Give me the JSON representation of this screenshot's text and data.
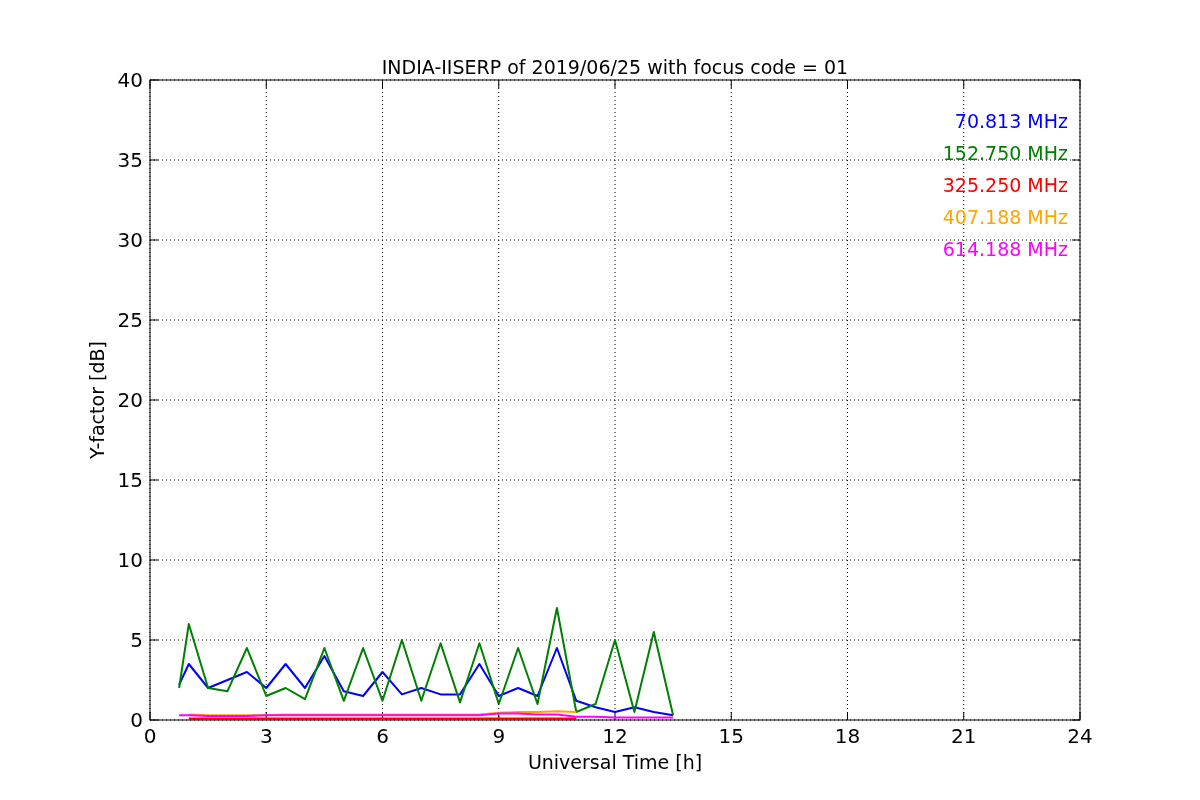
{
  "chart_data": {
    "type": "line",
    "title": "INDIA-IISERP of 2019/06/25 with focus code = 01",
    "xlabel": "Universal Time [h]",
    "ylabel": "Y-factor [dB]",
    "x": [
      0.75,
      1,
      1.5,
      2,
      2.5,
      3,
      3.5,
      4,
      4.5,
      5,
      5.5,
      6,
      6.5,
      7,
      7.5,
      8,
      8.5,
      9,
      9.5,
      10,
      10.5,
      11,
      11.5,
      12,
      12.5,
      13,
      13.5
    ],
    "series": [
      {
        "name": "70.813 MHz",
        "color": "#0000ff",
        "values": [
          2.2,
          3.5,
          2.0,
          2.5,
          3.0,
          2.0,
          3.5,
          2.0,
          4.0,
          1.8,
          1.5,
          3.0,
          1.6,
          2.0,
          1.6,
          1.6,
          3.5,
          1.5,
          2.0,
          1.5,
          4.5,
          1.2,
          0.8,
          0.5,
          0.8,
          0.5,
          0.3
        ]
      },
      {
        "name": "152.750 MHz",
        "color": "#008000",
        "values": [
          2.0,
          6.0,
          2.0,
          1.8,
          4.5,
          1.5,
          2.0,
          1.3,
          4.5,
          1.2,
          4.5,
          1.2,
          5.0,
          1.2,
          4.8,
          1.1,
          4.8,
          1.0,
          4.5,
          1.0,
          7.0,
          0.5,
          1.0,
          5.0,
          0.5,
          5.5,
          0.3
        ]
      },
      {
        "name": "325.250 MHz",
        "color": "#ff0000",
        "values": [
          null,
          0.1,
          0.1,
          0.1,
          0.1,
          0.1,
          0.1,
          0.1,
          0.1,
          0.1,
          0.1,
          0.1,
          0.1,
          0.1,
          0.1,
          0.1,
          0.1,
          0.1,
          0.1,
          0.1,
          0.1,
          0.1,
          null,
          null,
          null,
          null,
          null
        ]
      },
      {
        "name": "407.188 MHz",
        "color": "#ffa500",
        "values": [
          null,
          0.35,
          0.3,
          0.3,
          0.3,
          0.3,
          0.35,
          0.35,
          0.35,
          0.35,
          0.35,
          0.35,
          0.35,
          0.35,
          0.35,
          0.35,
          0.35,
          0.45,
          0.5,
          0.5,
          0.55,
          0.5,
          null,
          null,
          null,
          null,
          null
        ]
      },
      {
        "name": "614.188 MHz",
        "color": "#ff00ff",
        "values": [
          0.3,
          0.3,
          0.25,
          0.25,
          0.25,
          0.3,
          0.3,
          0.3,
          0.3,
          0.3,
          0.3,
          0.3,
          0.3,
          0.3,
          0.3,
          0.3,
          0.3,
          0.4,
          0.4,
          0.35,
          0.35,
          0.2,
          0.2,
          0.15,
          0.15,
          0.15,
          0.15
        ]
      }
    ],
    "grid": true,
    "xlim": [
      0,
      24
    ],
    "ylim": [
      0,
      40
    ],
    "xticks": [
      0,
      3,
      6,
      9,
      12,
      15,
      18,
      21,
      24
    ],
    "yticks": [
      0,
      5,
      10,
      15,
      20,
      25,
      30,
      35,
      40
    ]
  }
}
